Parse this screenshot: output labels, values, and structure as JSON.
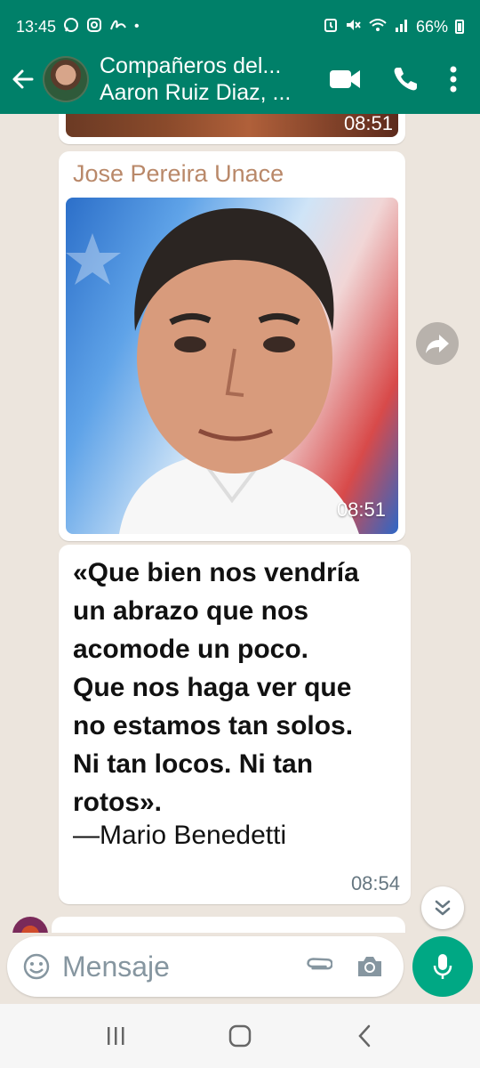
{
  "status_bar": {
    "time": "13:45",
    "left_icons": [
      "whatsapp-icon",
      "instagram-icon",
      "signature-icon",
      "dot-icon"
    ],
    "right_icons": [
      "alarm-icon",
      "mute-icon",
      "wifi-icon",
      "signal-icon"
    ],
    "battery": "66%"
  },
  "header": {
    "title": "Compañeros del...",
    "subtitle": "Aaron Ruiz Diaz, ...",
    "actions": [
      "video-call-icon",
      "voice-call-icon",
      "more-options-icon"
    ]
  },
  "messages": [
    {
      "type": "image",
      "time": "08:51",
      "partial": true
    },
    {
      "type": "image",
      "sender": "Jose Pereira Unace",
      "time": "08:51"
    },
    {
      "type": "text",
      "lines": [
        "«Que bien nos vendría",
        "un abrazo que nos",
        "acomode un poco.",
        "Que nos haga ver que",
        "no estamos tan solos.",
        "Ni tan locos. Ni tan",
        "rotos»."
      ],
      "author": "—Mario Benedetti",
      "time": "08:54"
    }
  ],
  "composer": {
    "placeholder": "Mensaje"
  },
  "colors": {
    "header": "#008069",
    "accent": "#00A884",
    "sender": "#B98869",
    "chat_bg": "#ECE5DD"
  }
}
